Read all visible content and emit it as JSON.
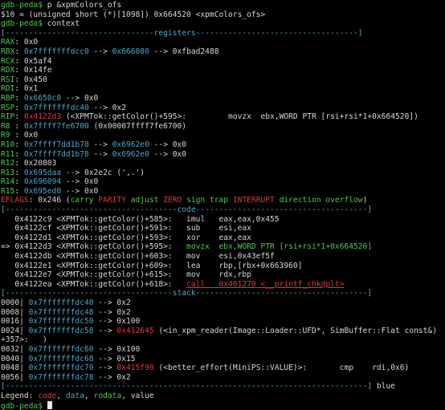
{
  "lines": [
    [
      {
        "t": "gdb-peda$ ",
        "c": "g"
      },
      {
        "t": "p &xpmColors_ofs",
        "c": "w"
      }
    ],
    [
      {
        "t": "$10 = (unsigned short (*)[1098]) 0x664520 <xpmColors_ofs>",
        "c": "w"
      }
    ],
    [
      {
        "t": "gdb-peda$ ",
        "c": "g"
      },
      {
        "t": "context",
        "c": "w"
      }
    ],
    [
      {
        "t": "[--------------------------------registers-----------------------------------]",
        "c": "c"
      }
    ],
    [
      {
        "t": "RAX",
        "c": "g"
      },
      {
        "t": ": 0x0",
        "c": "w"
      }
    ],
    [
      {
        "t": "RBX",
        "c": "g"
      },
      {
        "t": ": ",
        "c": "w"
      },
      {
        "t": "0x7fffffffdcc0",
        "c": "c"
      },
      {
        "t": " --> ",
        "c": "w"
      },
      {
        "t": "0x666080",
        "c": "c"
      },
      {
        "t": " --> 0xfbad2488",
        "c": "w"
      }
    ],
    [
      {
        "t": "RCX",
        "c": "g"
      },
      {
        "t": ": 0x5af4",
        "c": "w"
      }
    ],
    [
      {
        "t": "RDX",
        "c": "g"
      },
      {
        "t": ": 0x14fe",
        "c": "w"
      }
    ],
    [
      {
        "t": "RSI",
        "c": "g"
      },
      {
        "t": ": 0x450",
        "c": "w"
      }
    ],
    [
      {
        "t": "RDI",
        "c": "g"
      },
      {
        "t": ": 0x1",
        "c": "w"
      }
    ],
    [
      {
        "t": "RBP",
        "c": "g"
      },
      {
        "t": ": ",
        "c": "w"
      },
      {
        "t": "0x6650c8",
        "c": "c"
      },
      {
        "t": " --> 0x0",
        "c": "w"
      }
    ],
    [
      {
        "t": "RSP",
        "c": "g"
      },
      {
        "t": ": ",
        "c": "w"
      },
      {
        "t": "0x7fffffffdc40",
        "c": "c"
      },
      {
        "t": " --> 0x2",
        "c": "w"
      }
    ],
    [
      {
        "t": "RIP",
        "c": "g"
      },
      {
        "t": ": ",
        "c": "w"
      },
      {
        "t": "0x4122d3",
        "c": "r"
      },
      {
        "t": " (<XPMTok::getColor()+595>:         movzx  ebx,WORD PTR [rsi+rsi*1+0x664520])",
        "c": "w"
      }
    ],
    [
      {
        "t": "R8 ",
        "c": "g"
      },
      {
        "t": ": ",
        "c": "w"
      },
      {
        "t": "0x7ffff7fe6700",
        "c": "c"
      },
      {
        "t": " (0x00007ffff7fe6700)",
        "c": "w"
      }
    ],
    [
      {
        "t": "R9 ",
        "c": "g"
      },
      {
        "t": ": 0x0",
        "c": "w"
      }
    ],
    [
      {
        "t": "R10",
        "c": "g"
      },
      {
        "t": ": ",
        "c": "w"
      },
      {
        "t": "0x7ffff7dd1b78",
        "c": "c"
      },
      {
        "t": " --> ",
        "c": "w"
      },
      {
        "t": "0x6962e0",
        "c": "c"
      },
      {
        "t": " --> 0x0",
        "c": "w"
      }
    ],
    [
      {
        "t": "R11",
        "c": "g"
      },
      {
        "t": ": ",
        "c": "w"
      },
      {
        "t": "0x7ffff7dd1b78",
        "c": "c"
      },
      {
        "t": " --> ",
        "c": "w"
      },
      {
        "t": "0x6962e0",
        "c": "c"
      },
      {
        "t": " --> 0x0",
        "c": "w"
      }
    ],
    [
      {
        "t": "R12",
        "c": "g"
      },
      {
        "t": ": 0x20803",
        "c": "w"
      }
    ],
    [
      {
        "t": "R13",
        "c": "g"
      },
      {
        "t": ": ",
        "c": "w"
      },
      {
        "t": "0x695daa",
        "c": "c"
      },
      {
        "t": " --> 0x2e2c (',.')",
        "c": "w"
      }
    ],
    [
      {
        "t": "R14",
        "c": "g"
      },
      {
        "t": ": ",
        "c": "w"
      },
      {
        "t": "0x696094",
        "c": "c"
      },
      {
        "t": " --> 0x0",
        "c": "w"
      }
    ],
    [
      {
        "t": "R15",
        "c": "g"
      },
      {
        "t": ": ",
        "c": "w"
      },
      {
        "t": "0x695ed0",
        "c": "c"
      },
      {
        "t": " --> 0x0",
        "c": "w"
      }
    ],
    [
      {
        "t": "EFLAGS",
        "c": "r"
      },
      {
        "t": ": 0x246 (",
        "c": "w"
      },
      {
        "t": "carry ",
        "c": "g"
      },
      {
        "t": "PARITY ",
        "c": "r"
      },
      {
        "t": "adjust ",
        "c": "g"
      },
      {
        "t": "ZERO ",
        "c": "r"
      },
      {
        "t": "sign trap ",
        "c": "g"
      },
      {
        "t": "INTERRUPT ",
        "c": "r"
      },
      {
        "t": "direction overflow",
        "c": "g"
      },
      {
        "t": ")",
        "c": "w"
      }
    ],
    [
      {
        "t": "[-------------------------------------code-------------------------------------]",
        "c": "c"
      }
    ],
    [
      {
        "t": "   0x4122c9 <XPMTok::getColor()+585>:   imul   eax,eax,0x455",
        "c": "w"
      }
    ],
    [
      {
        "t": "   0x4122cf <XPMTok::getColor()+591>:   sub    esi,eax",
        "c": "w"
      }
    ],
    [
      {
        "t": "   0x4122d1 <XPMTok::getColor()+593>:   xor    eax,eax",
        "c": "w"
      }
    ],
    [
      {
        "t": "=> 0x4122d3 <XPMTok::getColor()+595>:   ",
        "c": "w"
      },
      {
        "t": "movzx  ebx,WORD PTR [rsi+rsi*1+0x664520]",
        "c": "g"
      }
    ],
    [
      {
        "t": "   0x4122db <XPMTok::getColor()+603>:   mov    esi,0x43ef5f",
        "c": "w"
      }
    ],
    [
      {
        "t": "   0x4122e1 <XPMTok::getColor()+609>:   lea    rbp,[rbx+0x663960]",
        "c": "w"
      }
    ],
    [
      {
        "t": "   0x4122e7 <XPMTok::getColor()+615>:   mov    rdx,rbp",
        "c": "w"
      }
    ],
    [
      {
        "t": "   0x4122ea <XPMTok::getColor()+618>:   ",
        "c": "w"
      },
      {
        "t": "call   0x401270 <__printf_chk@plt>",
        "c": "r",
        "u": true
      }
    ],
    [
      {
        "t": "[------------------------------------stack-------------------------------------]",
        "c": "c"
      }
    ],
    [
      {
        "t": "0000| ",
        "c": "w"
      },
      {
        "t": "0x7fffffffdc40",
        "c": "c"
      },
      {
        "t": " --> 0x2",
        "c": "w"
      }
    ],
    [
      {
        "t": "0008| ",
        "c": "w"
      },
      {
        "t": "0x7fffffffdc48",
        "c": "c"
      },
      {
        "t": " --> 0x2",
        "c": "w"
      }
    ],
    [
      {
        "t": "0016| ",
        "c": "w"
      },
      {
        "t": "0x7fffffffdc50",
        "c": "c"
      },
      {
        "t": " --> 0x100",
        "c": "w"
      }
    ],
    [
      {
        "t": "0024| ",
        "c": "w"
      },
      {
        "t": "0x7fffffffdc58",
        "c": "c"
      },
      {
        "t": " --> ",
        "c": "w"
      },
      {
        "t": "0x412645",
        "c": "r"
      },
      {
        "t": " (<in_xpm_reader(Image::Loader::UFD*, SimBuffer::Flat const&)",
        "c": "w"
      }
    ],
    [
      {
        "t": "+357>:   )",
        "c": "w"
      }
    ],
    [
      {
        "t": "0032| ",
        "c": "w"
      },
      {
        "t": "0x7fffffffdc60",
        "c": "c"
      },
      {
        "t": " --> 0x100",
        "c": "w"
      }
    ],
    [
      {
        "t": "0040| ",
        "c": "w"
      },
      {
        "t": "0x7fffffffdc68",
        "c": "c"
      },
      {
        "t": " --> 0x15",
        "c": "w"
      }
    ],
    [
      {
        "t": "0048| ",
        "c": "w"
      },
      {
        "t": "0x7fffffffdc70",
        "c": "c"
      },
      {
        "t": " --> ",
        "c": "w"
      },
      {
        "t": "0x415f90",
        "c": "r"
      },
      {
        "t": " (<better_effort(MiniPS::VALUE)>:       cmp    rdi,0x6)",
        "c": "w"
      }
    ],
    [
      {
        "t": "0056| ",
        "c": "w"
      },
      {
        "t": "0x7fffffffdc78",
        "c": "c"
      },
      {
        "t": " --> 0x2",
        "c": "w"
      }
    ],
    [
      {
        "t": "[------------------------------------------------------------------------------]",
        "c": "c"
      },
      {
        "t": " blue",
        "c": "w"
      }
    ],
    [
      {
        "t": "Legend: ",
        "c": "w"
      },
      {
        "t": "code",
        "c": "r"
      },
      {
        "t": ", ",
        "c": "w"
      },
      {
        "t": "data",
        "c": "c"
      },
      {
        "t": ", ",
        "c": "w"
      },
      {
        "t": "rodata",
        "c": "g"
      },
      {
        "t": ", value",
        "c": "w"
      }
    ],
    [
      {
        "t": "gdb-peda$ ",
        "c": "g"
      }
    ]
  ]
}
